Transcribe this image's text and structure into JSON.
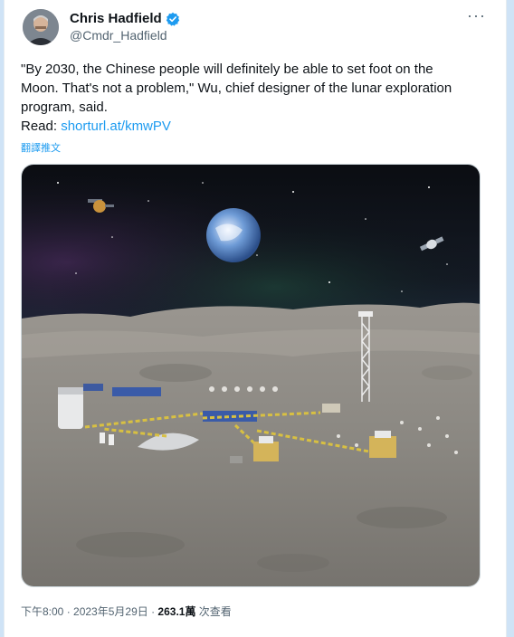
{
  "author": {
    "display_name": "Chris Hadfield",
    "handle": "@Cmdr_Hadfield",
    "verified_icon": "verified-badge-icon",
    "verified_color": "#1d9bf0"
  },
  "tweet": {
    "line1": "\"By 2030, the Chinese people will definitely be able to set foot on the",
    "line2": "Moon. That's not a problem,\" Wu, chief designer of the lunar exploration",
    "line3": "program, said.",
    "read_label": "Read: ",
    "link_text": "shorturl.at/kmwPV",
    "translate_label": "翻譯推文"
  },
  "meta": {
    "time": "下午8:00",
    "date": "2023年5月29日",
    "views_count": "263.1萬",
    "views_label": "次查看",
    "separator": " · "
  },
  "colors": {
    "link": "#1d9bf0",
    "text": "#0f1419",
    "muted": "#536471"
  }
}
